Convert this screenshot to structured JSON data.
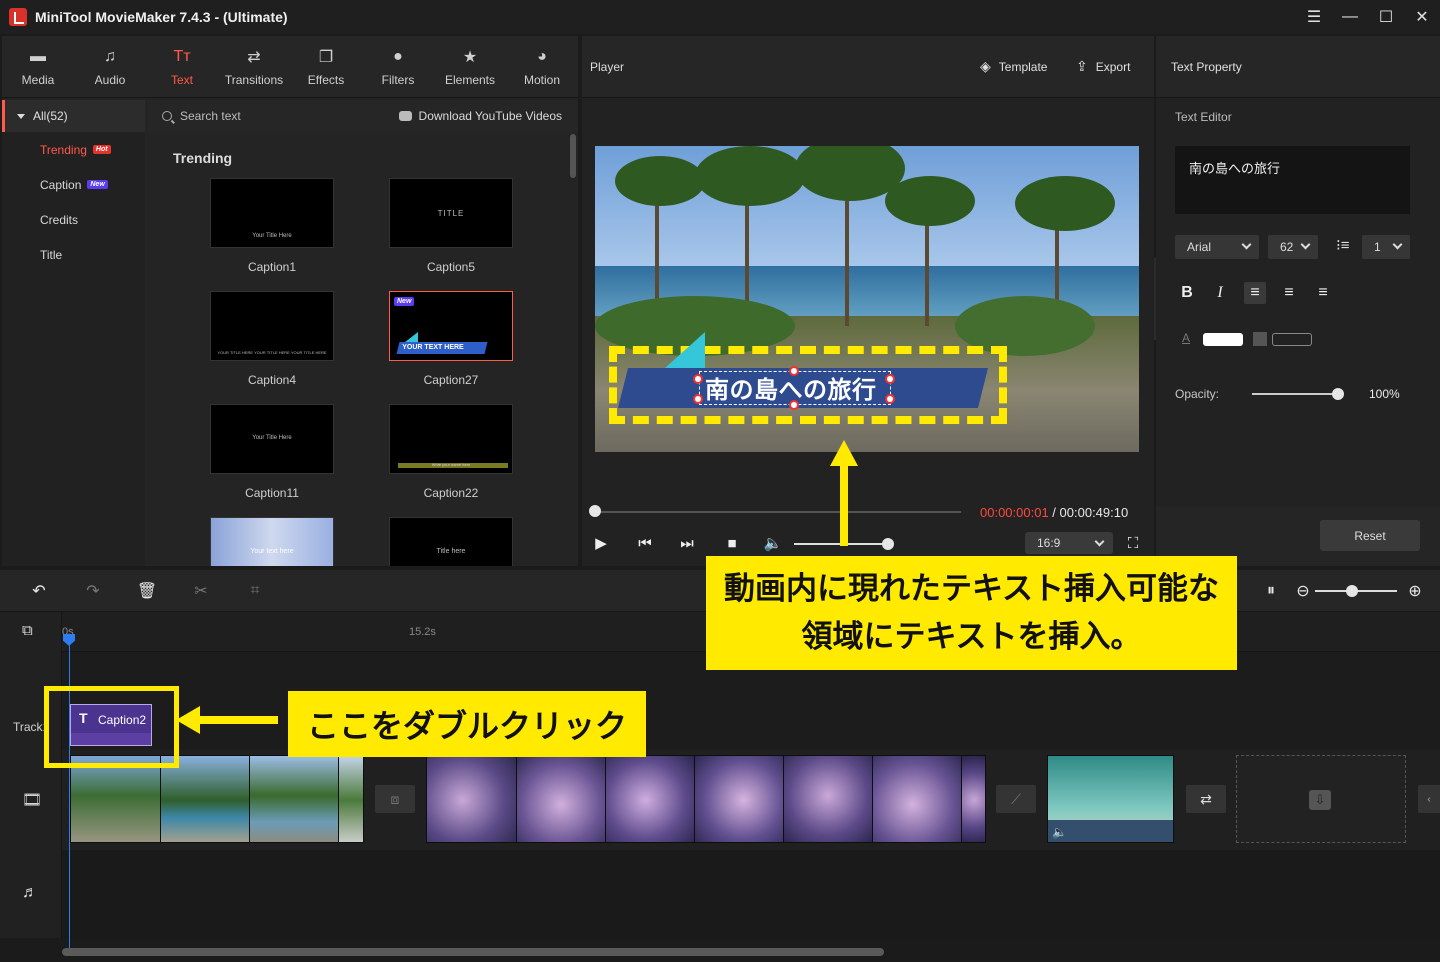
{
  "window": {
    "title": "MiniTool MovieMaker 7.4.3 - (Ultimate)",
    "controls": [
      "☰",
      "—",
      "☐",
      "✕"
    ]
  },
  "toolbar": {
    "items": [
      {
        "label": "Media",
        "icon": "media-icon",
        "glyph": "▬"
      },
      {
        "label": "Audio",
        "icon": "music-note-icon",
        "glyph": "♫"
      },
      {
        "label": "Text",
        "icon": "text-icon",
        "glyph": "Tт",
        "active": true
      },
      {
        "label": "Transitions",
        "icon": "transition-icon",
        "glyph": "⇄"
      },
      {
        "label": "Effects",
        "icon": "effects-icon",
        "glyph": "❐"
      },
      {
        "label": "Filters",
        "icon": "filters-icon",
        "glyph": "●"
      },
      {
        "label": "Elements",
        "icon": "elements-icon",
        "glyph": "★"
      },
      {
        "label": "Motion",
        "icon": "motion-icon",
        "glyph": "◕"
      }
    ]
  },
  "categories": {
    "all_label": "All(52)",
    "items": [
      {
        "label": "Trending",
        "badge": "Hot",
        "active": true
      },
      {
        "label": "Caption",
        "badge": "New"
      },
      {
        "label": "Credits",
        "badge": ""
      },
      {
        "label": "Title",
        "badge": ""
      }
    ]
  },
  "search": {
    "placeholder": "Search text",
    "youtube_label": "Download YouTube Videos"
  },
  "library": {
    "section_title": "Trending",
    "thumbnails": [
      {
        "label": "Caption1",
        "preview": "Your  Title  Here"
      },
      {
        "label": "Caption5",
        "preview": "TITLE"
      },
      {
        "label": "Caption4",
        "preview": "YOUR TITLE HERE YOUR TITLE HERE YOUR TITLE HERE"
      },
      {
        "label": "Caption27",
        "preview": "YOUR TEXT HERE",
        "badge": "New",
        "selected": true
      },
      {
        "label": "Caption11",
        "preview": "Your   Title Here"
      },
      {
        "label": "Caption22",
        "preview": "Write your name here"
      },
      {
        "label": "",
        "preview": "Your text here"
      },
      {
        "label": "",
        "preview": "Title here"
      }
    ]
  },
  "player": {
    "title": "Player",
    "template_label": "Template",
    "export_label": "Export",
    "overlay_text": "南の島への旅行",
    "progress": 0.0,
    "current_time": "00:00:00:01",
    "separator": " / ",
    "total_time": "00:00:49:10",
    "volume": 1.0,
    "aspect_ratio": "16:9"
  },
  "text_property": {
    "title": "Text Property",
    "editor_label": "Text Editor",
    "editor_value": "南の島への旅行",
    "font": "Arial",
    "size": "62",
    "line_spacing": "1",
    "format_buttons": [
      "B",
      "I",
      "≡",
      "≡",
      "≡"
    ],
    "opacity_label": "Opacity:",
    "opacity_value": "100%",
    "opacity": 1.0,
    "reset_label": "Reset",
    "text_color": "#ffffff"
  },
  "timeline": {
    "ruler_labels": [
      "0s",
      "15.2s"
    ],
    "track_label": "Track1",
    "caption_clip_label": "Caption2",
    "zoom": 0.45
  },
  "annotations": {
    "top_callout": "動画内に現れたテキスト挿入可能な領域にテキストを挿入。",
    "bottom_callout": "ここをダブルクリック",
    "highlight_color": "#ffea00"
  },
  "colors": {
    "accent": "#ff5a4a",
    "playhead": "#2d7cf0",
    "caption_clip": "#5d3fa3"
  }
}
